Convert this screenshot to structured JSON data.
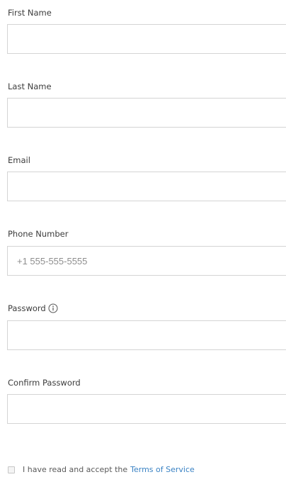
{
  "form": {
    "first_name": {
      "label": "First Name",
      "value": "",
      "placeholder": ""
    },
    "last_name": {
      "label": "Last Name",
      "value": "",
      "placeholder": ""
    },
    "email": {
      "label": "Email",
      "value": "",
      "placeholder": ""
    },
    "phone": {
      "label": "Phone Number",
      "value": "",
      "placeholder": "+1 555-555-5555"
    },
    "password": {
      "label": "Password",
      "value": "",
      "placeholder": "",
      "icon": "info-icon"
    },
    "confirm_password": {
      "label": "Confirm Password",
      "value": "",
      "placeholder": ""
    },
    "terms": {
      "checked": false,
      "text": "I have read and accept the",
      "link_text": "Terms of Service"
    }
  },
  "colors": {
    "link": "#3b83c4",
    "border": "#d4d4d4",
    "label": "#3c3c3c"
  }
}
